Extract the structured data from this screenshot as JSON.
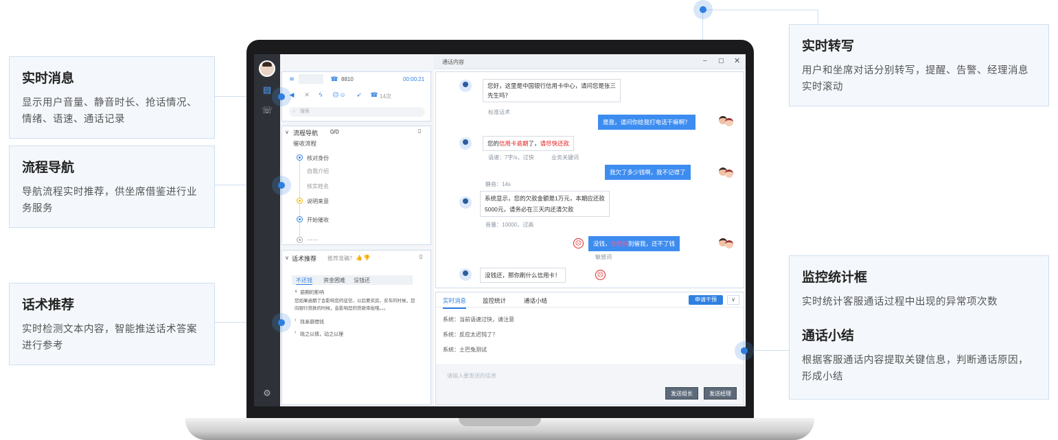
{
  "callouts": {
    "realtime_msg": {
      "title": "实时消息",
      "desc": "显示用户音量、静音时长、抢话情况、情绪、语速、通话记录"
    },
    "flow_nav": {
      "title": "流程导航",
      "desc": "导航流程实时推荐，供坐席借鉴进行业务服务"
    },
    "script_rec": {
      "title": "话术推荐",
      "desc": "实时检测文本内容，智能推送话术答案进行参考"
    },
    "transcribe": {
      "title": "实时转写",
      "desc": "用户和坐席对话分别转写，提醒、告警、经理消息实时滚动"
    },
    "monitor": {
      "title": "监控统计框",
      "desc": "实时统计客服通话过程中出现的异常项次数",
      "title2": "通话小结",
      "desc2": "根据客服通话内容提取关键信息，判断通话原因，形成小结"
    }
  },
  "app": {
    "call_panel": {
      "ext": "8810",
      "timer": "00:00:21",
      "count": "14次",
      "search_placeholder": "搜索"
    },
    "flow": {
      "title": "流程导航",
      "progress": "0/0",
      "name": "催收流程",
      "steps": [
        "核对身份",
        "自我介绍",
        "核实姓名",
        "说明来意",
        "开始催收",
        "……"
      ]
    },
    "talk": {
      "title": "话术推荐",
      "accuracy": "推荐准确？",
      "tabs": [
        "不还钱",
        "资金困难",
        "没钱还"
      ],
      "section1": "逾期的影响",
      "body": "您如果逾期了会影响您的征信，以后要买房，买车的时候，您向银行贷款的时候，会影响您的贷款审批哦。。。",
      "item2": "找亲朋借钱",
      "item3": "晓之以情，动之以理"
    },
    "window_title": "通话内容",
    "chat": {
      "m1": "您好，这里是中国银行信用卡中心，请问您是张三",
      "m1b": "先生吗？",
      "n1": "标准话术",
      "c1": "是我，请问你给我打电话干嘛啊？",
      "m2a": "您的",
      "m2b": "信用卡逾期",
      "m2c": "了，",
      "m2d": "请尽快还款",
      "n2a": "语速：7字/s，过快",
      "n2b": "业务关键词",
      "c2": "我欠了多少钱啊，我不记得了",
      "n3": "静音：14s",
      "m3": "系统显示，您的欠款金额是1万元，本期应还款",
      "m3b": "5000元，请务必在三天内还清欠款",
      "n4": "音量：10000，过高",
      "c3a": "没钱，",
      "c3b": "你他妈",
      "c3c": "别催我，还不了钱",
      "n5": "敏感词",
      "m4": "没钱还，那你刷什么信用卡！"
    },
    "bottom": {
      "tabs": [
        "实时消息",
        "监控统计",
        "通话小结"
      ],
      "intervene": "申请干预",
      "sys": [
        "系统：当前语速过快，请注意",
        "系统：反应太迟钝了？",
        "系统：土巴兔测试"
      ],
      "placeholder": "请输入要发送的信息",
      "send_leader": "发送组长",
      "send_manager": "发送经理"
    }
  }
}
